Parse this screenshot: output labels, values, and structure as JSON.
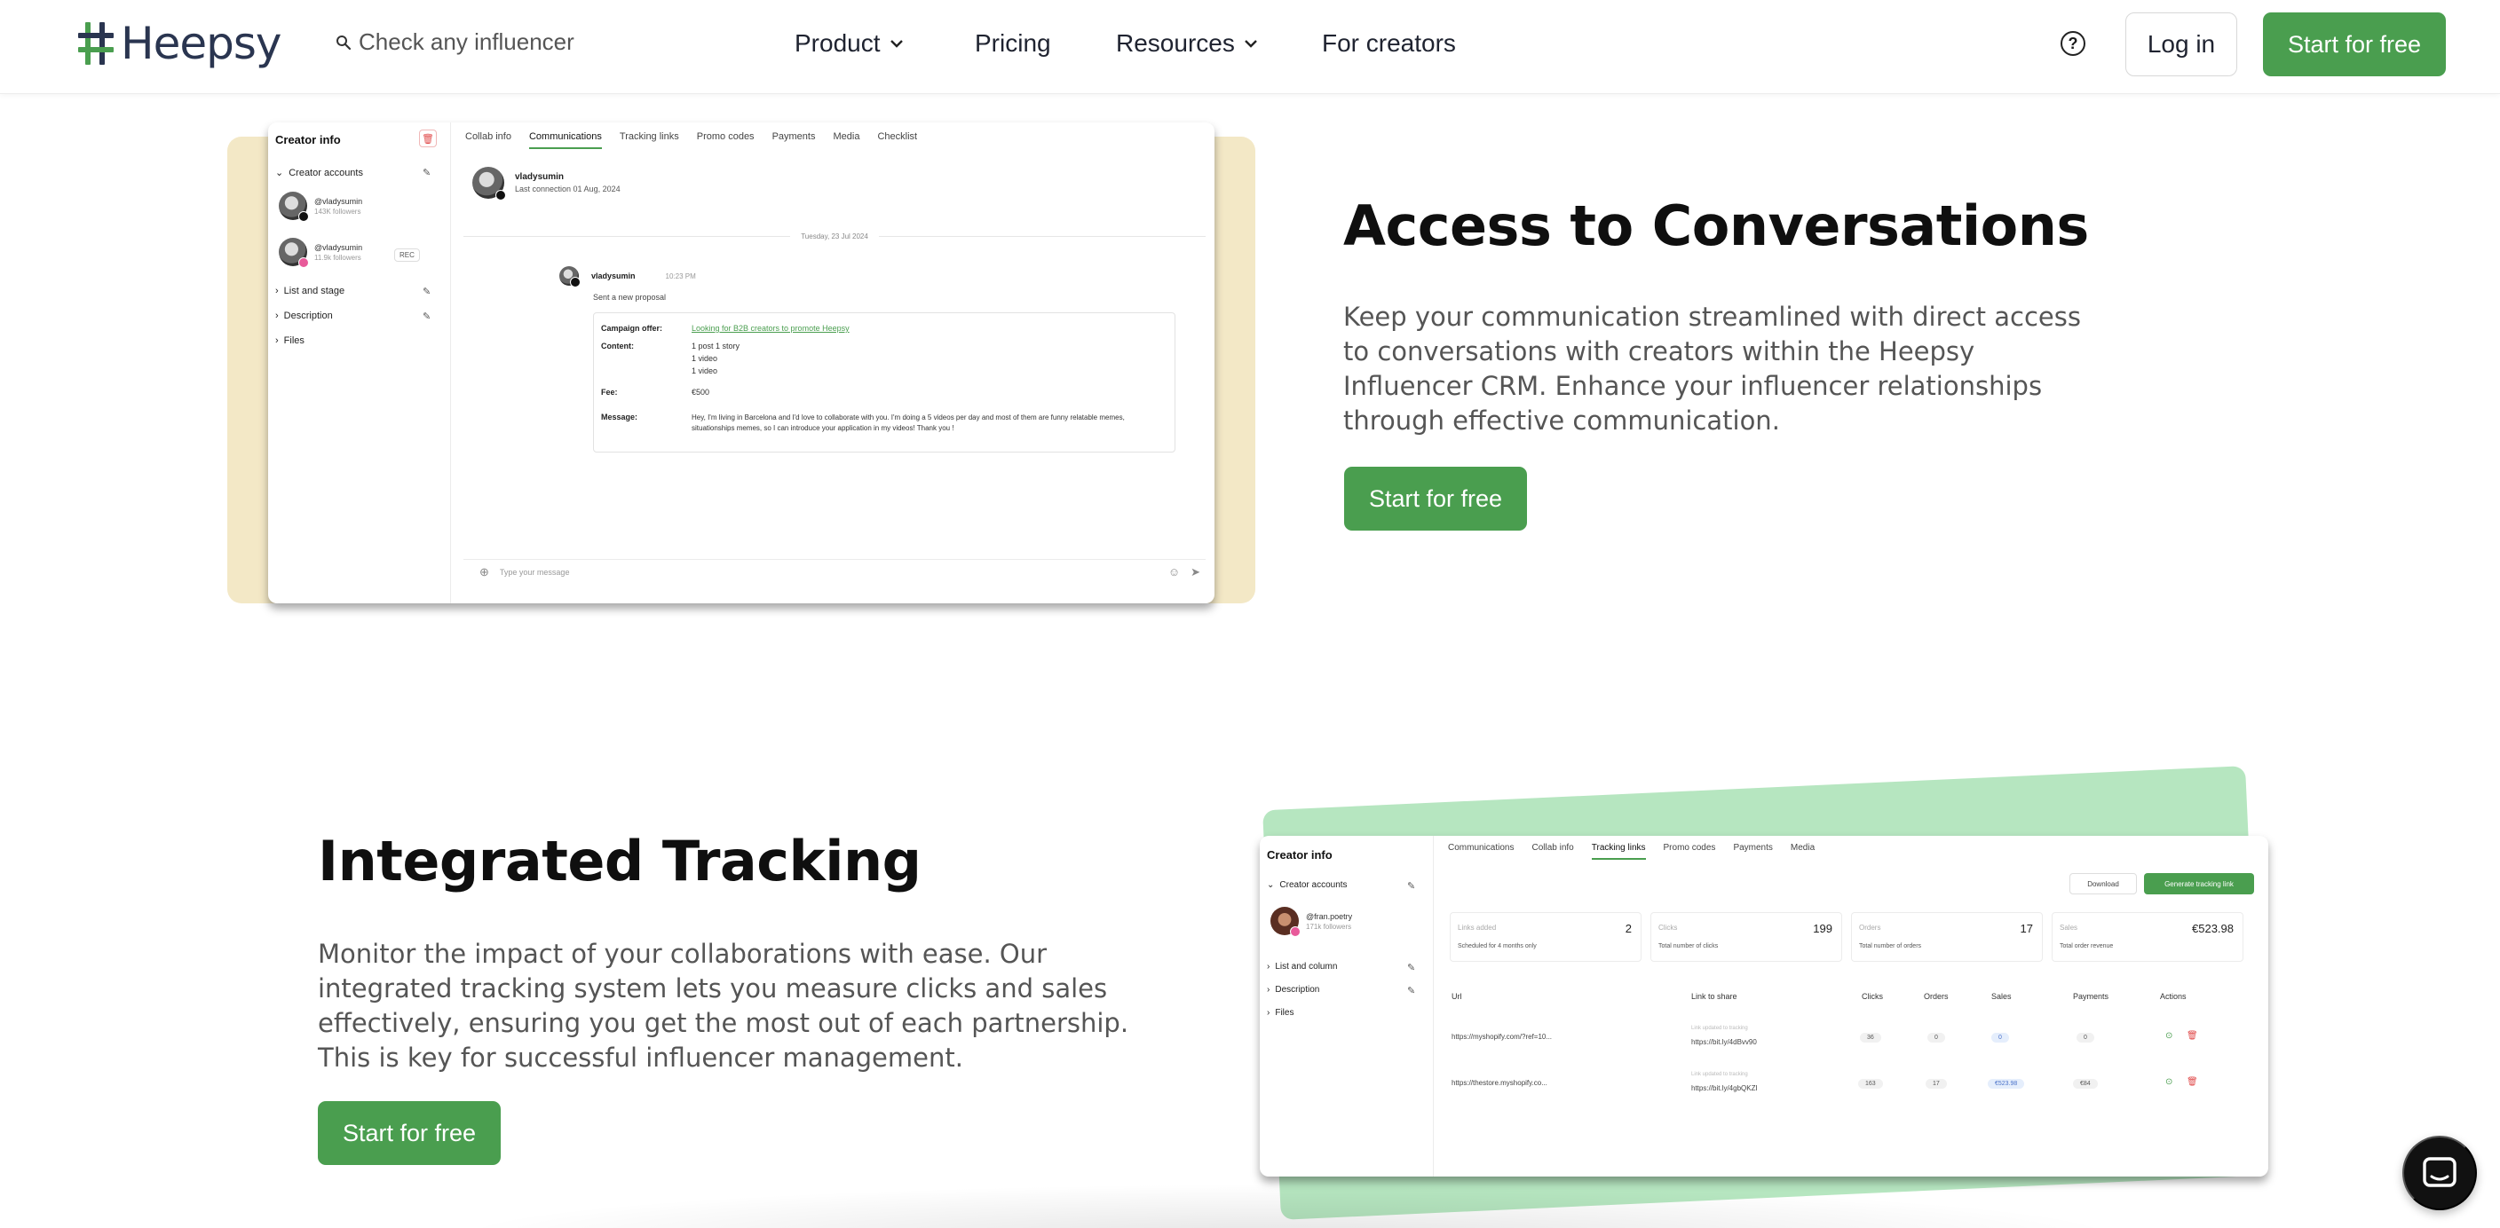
{
  "nav": {
    "brand": "Heepsy",
    "search_placeholder": "Check any influencer",
    "links": {
      "product": "Product",
      "pricing": "Pricing",
      "resources": "Resources",
      "creators": "For creators"
    },
    "help_symbol": "?",
    "login": "Log in",
    "start": "Start for free"
  },
  "section1": {
    "title": "Access to Conversations",
    "text": "Keep your communication streamlined with direct access to conversations with creators within the Heepsy Influencer CRM. Enhance your influencer relationships through effective communication.",
    "cta": "Start for free",
    "screenshot": {
      "sidebar_title": "Creator info",
      "creator_accounts": "Creator accounts",
      "accounts": [
        {
          "handle": "@vladysumin",
          "followers": "143K followers"
        },
        {
          "handle": "@vladysumin",
          "followers": "11.9k followers"
        }
      ],
      "rec_label": "REC",
      "sections": [
        "List and stage",
        "Description",
        "Files"
      ],
      "tabs": [
        "Collab info",
        "Communications",
        "Tracking links",
        "Promo codes",
        "Payments",
        "Media",
        "Checklist"
      ],
      "active_tab": "Communications",
      "chat_user": "vladysumin",
      "last_connection": "Last connection 01 Aug, 2024",
      "date_separator": "Tuesday, 23 Jul 2024",
      "message_user": "vladysumin",
      "message_time": "10:23 PM",
      "message_subtitle": "Sent a new proposal",
      "proposal": {
        "campaign_label": "Campaign offer:",
        "campaign_value": "Looking for B2B creators to promote Heepsy",
        "content_label": "Content:",
        "content_values": [
          "1 post  1 story",
          "1 video",
          "1 video"
        ],
        "fee_label": "Fee:",
        "fee_value": "€500",
        "message_label": "Message:",
        "message_value": "Hey, I'm living in Barcelona and I'd love to collaborate with you. I'm doing a 5 videos per day and most of them are funny relatable memes, situationships memes, so I can introduce your application in my videos! Thank you !"
      },
      "compose_placeholder": "Type your message"
    }
  },
  "section2": {
    "title": "Integrated Tracking",
    "text": "Monitor the impact of your collaborations with ease. Our integrated tracking system lets you measure clicks and sales effectively, ensuring you get the most out of each partnership. This is key for successful influencer management.",
    "cta": "Start for free",
    "screenshot": {
      "sidebar_title": "Creator info",
      "creator_accounts": "Creator accounts",
      "account": {
        "handle": "@fran.poetry",
        "followers": "171k followers"
      },
      "sections": [
        "List and column",
        "Description",
        "Files"
      ],
      "tabs": [
        "Communications",
        "Collab info",
        "Tracking links",
        "Promo codes",
        "Payments",
        "Media"
      ],
      "active_tab": "Tracking links",
      "download": "Download",
      "generate": "Generate tracking link",
      "stats": [
        {
          "label": "Links added",
          "value": "2",
          "sub": "Scheduled for 4 months only"
        },
        {
          "label": "Clicks",
          "value": "199",
          "sub": "Total number of clicks"
        },
        {
          "label": "Orders",
          "value": "17",
          "sub": "Total number of orders"
        },
        {
          "label": "Sales",
          "value": "€523.98",
          "sub": "Total order revenue"
        }
      ],
      "columns": [
        "Url",
        "Link to share",
        "Clicks",
        "Orders",
        "Sales",
        "Payments",
        "Actions"
      ],
      "rows": [
        {
          "url": "https://myshopify.com/?ref=10...",
          "share_label": "Link updated to tracking",
          "share": "https://bit.ly/4dBvv90",
          "clicks": "36",
          "orders": "0",
          "sales": "0",
          "payments": "0"
        },
        {
          "url": "https://thestore.myshopify.co...",
          "share_label": "Link updated to tracking",
          "share": "https://bit.ly/4gbQKZI",
          "clicks": "163",
          "orders": "17",
          "sales": "€523.98",
          "payments": "€84"
        }
      ]
    }
  },
  "colors": {
    "brand_green": "#4a9e4f",
    "beige_panel": "#f3e8c6",
    "mint_panel": "#b6e6c0"
  },
  "icons": [
    "heepsy-logo-icon",
    "search-icon",
    "chevron-down-icon",
    "help-icon",
    "chat-bubble-icon",
    "edit-icon",
    "trash-icon",
    "send-icon",
    "emoji-icon",
    "add-icon",
    "copy-icon"
  ]
}
